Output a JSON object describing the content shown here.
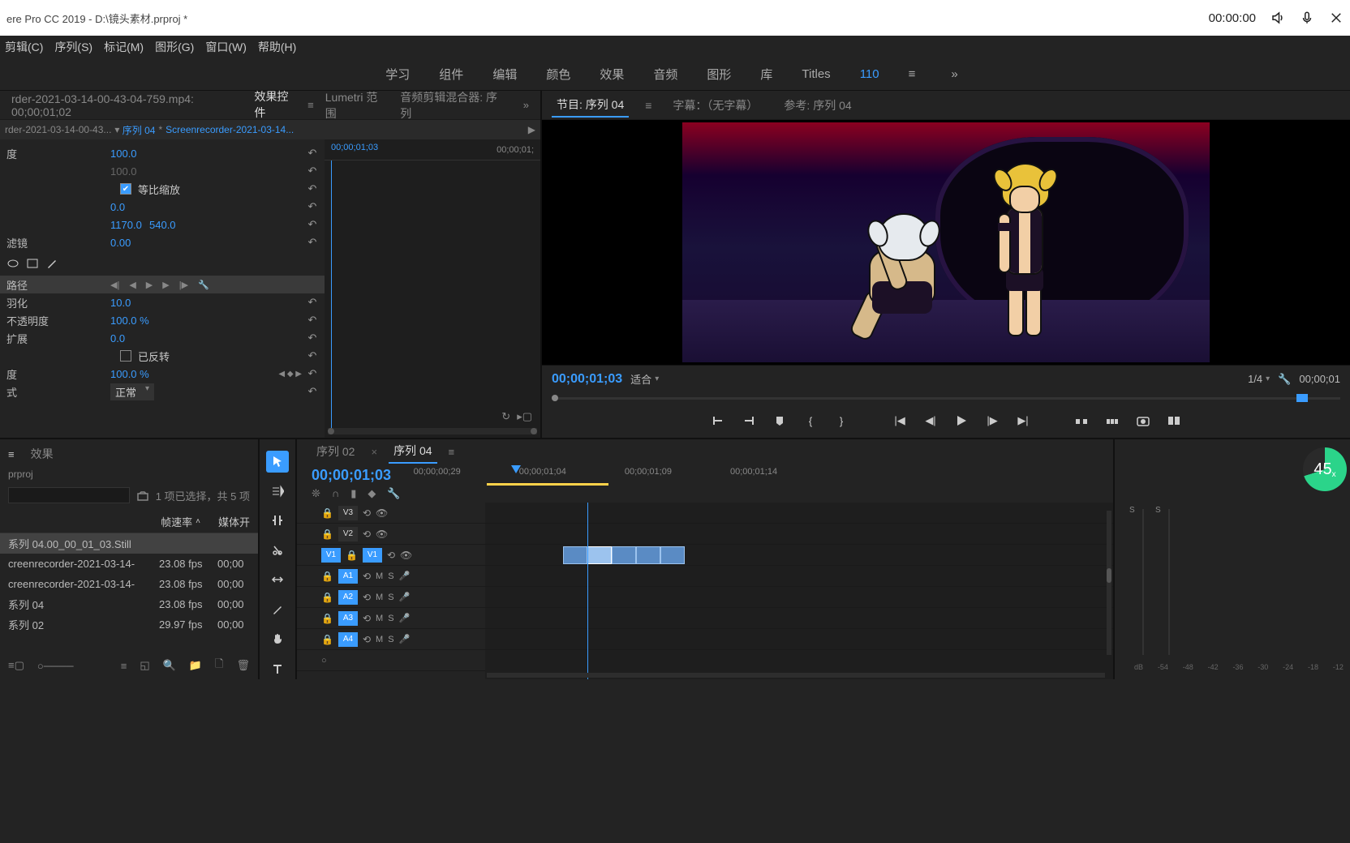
{
  "titlebar": {
    "app_title": "ere Pro CC 2019 - D:\\镜头素材.prproj *",
    "timecode": "00:00:00"
  },
  "menubar": [
    "剪辑(C)",
    "序列(S)",
    "标记(M)",
    "图形(G)",
    "窗口(W)",
    "帮助(H)"
  ],
  "workspaces": [
    "学习",
    "组件",
    "编辑",
    "颜色",
    "效果",
    "音频",
    "图形",
    "库",
    "Titles"
  ],
  "workspace_num": "110",
  "source_tabs": {
    "clip_path_grey": "rder-2021-03-14-00-43...",
    "clip_seq": "序列 04",
    "clip_file": "Screenrecorder-2021-03-14...",
    "effects_tab": "效果控件",
    "lumetri_tab": "Lumetri 范围",
    "audio_mixer_tab": "音频剪辑混合器: 序列",
    "source_clip_tab": "rder-2021-03-14-00-43-04-759.mp4: 00;00;01;02"
  },
  "effect_ruler": {
    "start": "00;00;01;03",
    "end": "00;00;01;"
  },
  "effect_props": {
    "scale": "度",
    "scale_val": "100.0",
    "scale_w": "100.0",
    "uniform_label": "等比缩放",
    "rotation_val": "0.0",
    "anchor_x": "1170.0",
    "anchor_y": "540.0",
    "anti_flicker": "滤镜",
    "anti_flicker_val": "0.00",
    "mask_path": "路径",
    "feather": "羽化",
    "feather_val": "10.0",
    "opacity_label": "不透明度",
    "opacity_val": "100.0 %",
    "expansion": "扩展",
    "expansion_val": "0.0",
    "inverted": "已反转",
    "opacity2": "度",
    "opacity2_val": "100.0 %",
    "blend": "式",
    "blend_val": "正常"
  },
  "program": {
    "tab_active": "节目: 序列 04",
    "subtitle_label": "字幕：（无字幕）",
    "ref_label": "参考: 序列 04",
    "timecode": "00;00;01;03",
    "fit": "适合",
    "res": "1/4",
    "right_tc": "00;00;01"
  },
  "project": {
    "tab_effects": "效果",
    "proj_name": "prproj",
    "sel_text": "1 项已选择，共 5 项",
    "col_rate": "帧速率",
    "col_media": "媒体开",
    "rows": [
      {
        "name": "系列 04.00_00_01_03.Still",
        "rate": "",
        "med": ""
      },
      {
        "name": "creenrecorder-2021-03-14-",
        "rate": "23.08 fps",
        "med": "00;00"
      },
      {
        "name": "creenrecorder-2021-03-14-",
        "rate": "23.08 fps",
        "med": "00;00"
      },
      {
        "name": "系列 04",
        "rate": "23.08 fps",
        "med": "00;00"
      },
      {
        "name": "系列 02",
        "rate": "29.97 fps",
        "med": "00;00"
      }
    ]
  },
  "timeline": {
    "tab1": "序列 02",
    "tab2": "序列 04",
    "timecode": "00;00;01;03",
    "ruler": [
      "00;00;00;29",
      "00;00;01;04",
      "00;00;01;09",
      "00;00;01;14"
    ],
    "tracks": {
      "v3": "V3",
      "v2": "V2",
      "v1": "V1",
      "v1src": "V1",
      "a1": "A1",
      "a2": "A2",
      "a3": "A3",
      "a4": "A4",
      "m": "M",
      "s": "S"
    }
  },
  "audio": {
    "fps": "45",
    "fps_x": "x",
    "s": "S",
    "db": [
      "dB",
      "-54",
      "-48",
      "-42",
      "-36",
      "-30",
      "-24",
      "-18",
      "-12"
    ]
  }
}
